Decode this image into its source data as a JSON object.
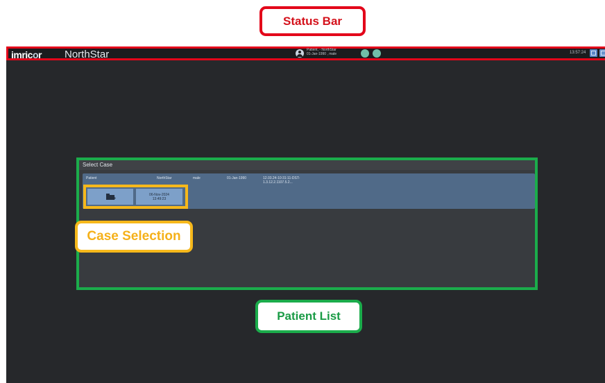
{
  "annotations": {
    "status_bar": "Status Bar",
    "patient_list": "Patient List",
    "case_selection": "Case Selection"
  },
  "status_bar": {
    "brand_prefix": "imric",
    "brand_o": "o",
    "brand_suffix": "r",
    "app_name": "NorthStar",
    "patient_name": "Patient, - NorthStar",
    "patient_details": "01-Jan-1990 , male",
    "clock": "13:57:24"
  },
  "panel": {
    "title": "Select Case",
    "row": {
      "patient": "Patient",
      "site": "NorthStar",
      "sex": "male",
      "dob": "01-Jan-1990",
      "study": "12.03.24-10:31:11-DST-1.3.12.2.1107.5.2..."
    },
    "case": {
      "date": "06-Nov-2024",
      "time": "13:49:23"
    }
  },
  "colors": {
    "status_bar_outline": "#e3061a",
    "patient_list_outline": "#1bac4b",
    "case_selection_outline": "#f6b81b",
    "app_background": "#26282b",
    "row_background": "#506a88",
    "button_background": "#7da0c9"
  },
  "icons": {
    "new_case": "folder-plus-icon",
    "patient": "user-circle-icon"
  }
}
